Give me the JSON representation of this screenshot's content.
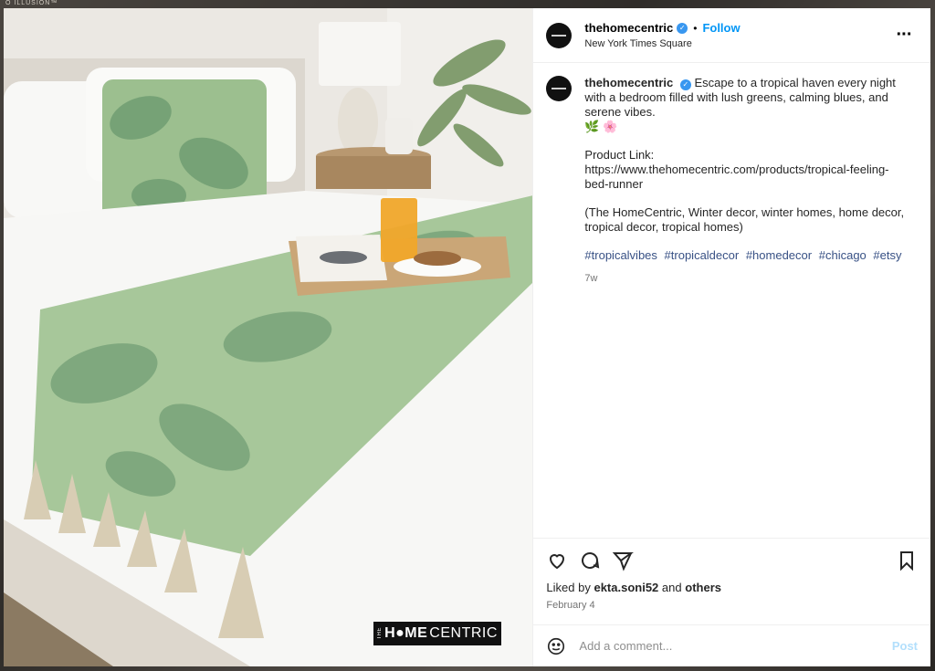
{
  "backdrop": {
    "brand_text": "O ILLUSION™"
  },
  "post": {
    "username": "thehomecentric",
    "verified_icon": "verified-badge-icon",
    "follow_label": "Follow",
    "location": "New York Times Square",
    "more_icon": "more-options-icon",
    "caption": {
      "username": "thehomecentric",
      "text": "Escape to a tropical haven every night with a bedroom filled with lush greens, calming blues, and serene vibes.",
      "emoji_leaf": "🌿",
      "emoji_flower": "🌸",
      "product_label": "Product Link:",
      "product_url": "https://www.thehomecentric.com/products/tropical-feeling-bed-runner",
      "tags_text": "(The HomeCentric, Winter decor, winter homes, home decor, tropical decor, tropical homes)",
      "hashtags": [
        "#tropicalvibes",
        "#tropicaldecor",
        "#homedecor",
        "#chicago",
        "#etsy"
      ],
      "age": "7w"
    },
    "likes": {
      "prefix": "Liked by",
      "user": "ekta.soni52",
      "and": "and",
      "others": "others"
    },
    "date": "February 4",
    "comment_placeholder": "Add a comment...",
    "post_label": "Post"
  },
  "media": {
    "watermark_pre": "THE",
    "watermark_bold": "H●ME",
    "watermark_rest": "CENTRIC"
  },
  "colors": {
    "link": "#0095f6",
    "hashtag": "#385185",
    "post_disabled": "#b2dffc"
  }
}
